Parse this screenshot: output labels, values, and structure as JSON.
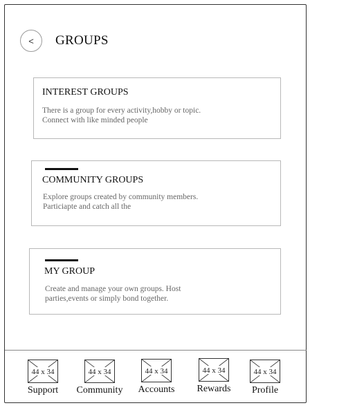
{
  "header": {
    "back_label": "<",
    "title": "GROUPS"
  },
  "cards": [
    {
      "title": "INTEREST GROUPS",
      "desc_line1": "There is a group for every activity,hobby or topic.",
      "desc_line2": "Connect with like minded people"
    },
    {
      "title": "COMMUNITY GROUPS",
      "desc_line1": "Explore groups created by community members.",
      "desc_line2": "Particiapte and catch all the"
    },
    {
      "title": "MY GROUP",
      "desc_line1": "Create and manage your own groups. Host",
      "desc_line2": "parties,events or simply bond together."
    }
  ],
  "nav": {
    "placeholder_text": "44 x 34",
    "items": [
      {
        "label": "Support",
        "icon": "image-placeholder-icon"
      },
      {
        "label": "Community",
        "icon": "image-placeholder-icon"
      },
      {
        "label": "Accounts",
        "icon": "image-placeholder-icon"
      },
      {
        "label": "Rewards",
        "icon": "image-placeholder-icon"
      },
      {
        "label": "Profile",
        "icon": "image-placeholder-icon"
      }
    ]
  },
  "colors": {
    "frame_border": "#333333",
    "card_border": "#b8b8b8",
    "accent_bar": "#111111",
    "desc_text": "#666666"
  }
}
